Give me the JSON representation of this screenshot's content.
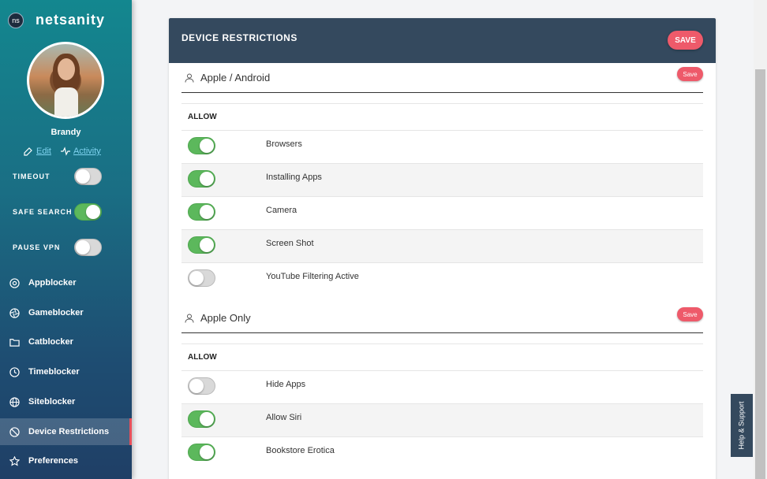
{
  "brand": {
    "logo": "ns",
    "name": "netsanity"
  },
  "profile": {
    "name": "Brandy",
    "edit_label": "Edit",
    "activity_label": "Activity"
  },
  "toggles": [
    {
      "label": "TIMEOUT",
      "on": false
    },
    {
      "label": "SAFE SEARCH",
      "on": true
    },
    {
      "label": "PAUSE VPN",
      "on": false
    }
  ],
  "nav": [
    {
      "label": "Appblocker",
      "icon": "chrome-icon"
    },
    {
      "label": "Gameblocker",
      "icon": "aperture-icon"
    },
    {
      "label": "Catblocker",
      "icon": "folder-icon"
    },
    {
      "label": "Timeblocker",
      "icon": "clock-icon"
    },
    {
      "label": "Siteblocker",
      "icon": "globe-icon"
    },
    {
      "label": "Device Restrictions",
      "icon": "ban-icon",
      "active": true
    },
    {
      "label": "Preferences",
      "icon": "star-icon"
    }
  ],
  "card": {
    "title": "DEVICE RESTRICTIONS",
    "save_label": "SAVE"
  },
  "sections": [
    {
      "title": "Apple / Android",
      "save_label": "Save",
      "allow_label": "ALLOW",
      "rows": [
        {
          "label": "Browsers",
          "on": true
        },
        {
          "label": "Installing Apps",
          "on": true
        },
        {
          "label": "Camera",
          "on": true
        },
        {
          "label": "Screen Shot",
          "on": true
        },
        {
          "label": "YouTube Filtering Active",
          "on": false
        }
      ]
    },
    {
      "title": "Apple Only",
      "save_label": "Save",
      "allow_label": "ALLOW",
      "rows": [
        {
          "label": "Hide Apps",
          "on": false
        },
        {
          "label": "Allow Siri",
          "on": true
        },
        {
          "label": "Bookstore Erotica",
          "on": true
        }
      ]
    }
  ],
  "help": {
    "label": "Help & Support"
  },
  "colors": {
    "accent": "#ee5a6a",
    "header": "#34495e",
    "toggle_on": "#5cb85c"
  }
}
